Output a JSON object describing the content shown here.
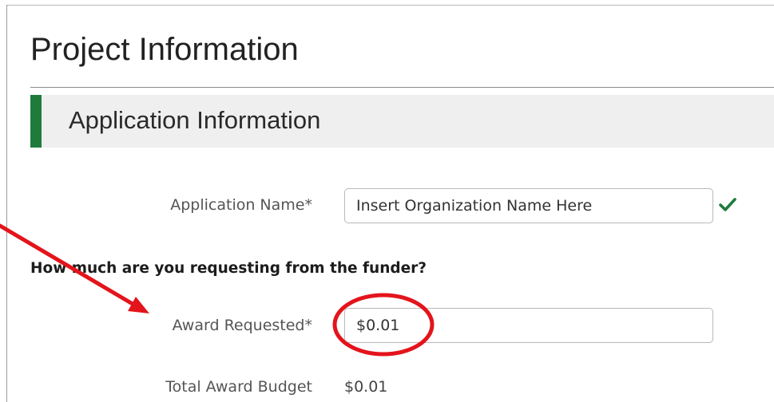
{
  "page": {
    "title": "Project Information"
  },
  "section": {
    "title": "Application Information",
    "accent_color": "#1e7b3c"
  },
  "form": {
    "application_name": {
      "label": "Application Name*",
      "value": "Insert Organization Name Here",
      "valid_icon": "check-icon",
      "valid_color": "#1e7b3c"
    },
    "question": "How much are you requesting from the funder?",
    "award_requested": {
      "label": "Award Requested*",
      "value": "$0.01"
    },
    "total_award_budget": {
      "label": "Total Award Budget",
      "value": "$0.01"
    }
  },
  "annotations": {
    "color": "#e3141b",
    "items": [
      "arrow pointing to Award Requested field",
      "circle around the Award Requested value"
    ]
  }
}
